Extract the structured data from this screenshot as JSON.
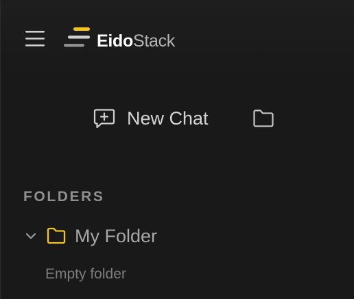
{
  "header": {
    "menu_icon": "hamburger-menu-icon",
    "logo": {
      "bold_text": "Eido",
      "light_text": "Stack",
      "accent_color": "#f4c51c"
    }
  },
  "actions": {
    "new_chat_label": "New Chat",
    "new_chat_icon": "chat-plus-icon",
    "new_folder_icon": "folder-icon"
  },
  "folders": {
    "heading": "FOLDERS",
    "items": [
      {
        "name": "My Folder",
        "expanded": true,
        "icon": "folder-icon",
        "icon_color": "#f4c51c",
        "empty_text": "Empty folder"
      }
    ]
  }
}
